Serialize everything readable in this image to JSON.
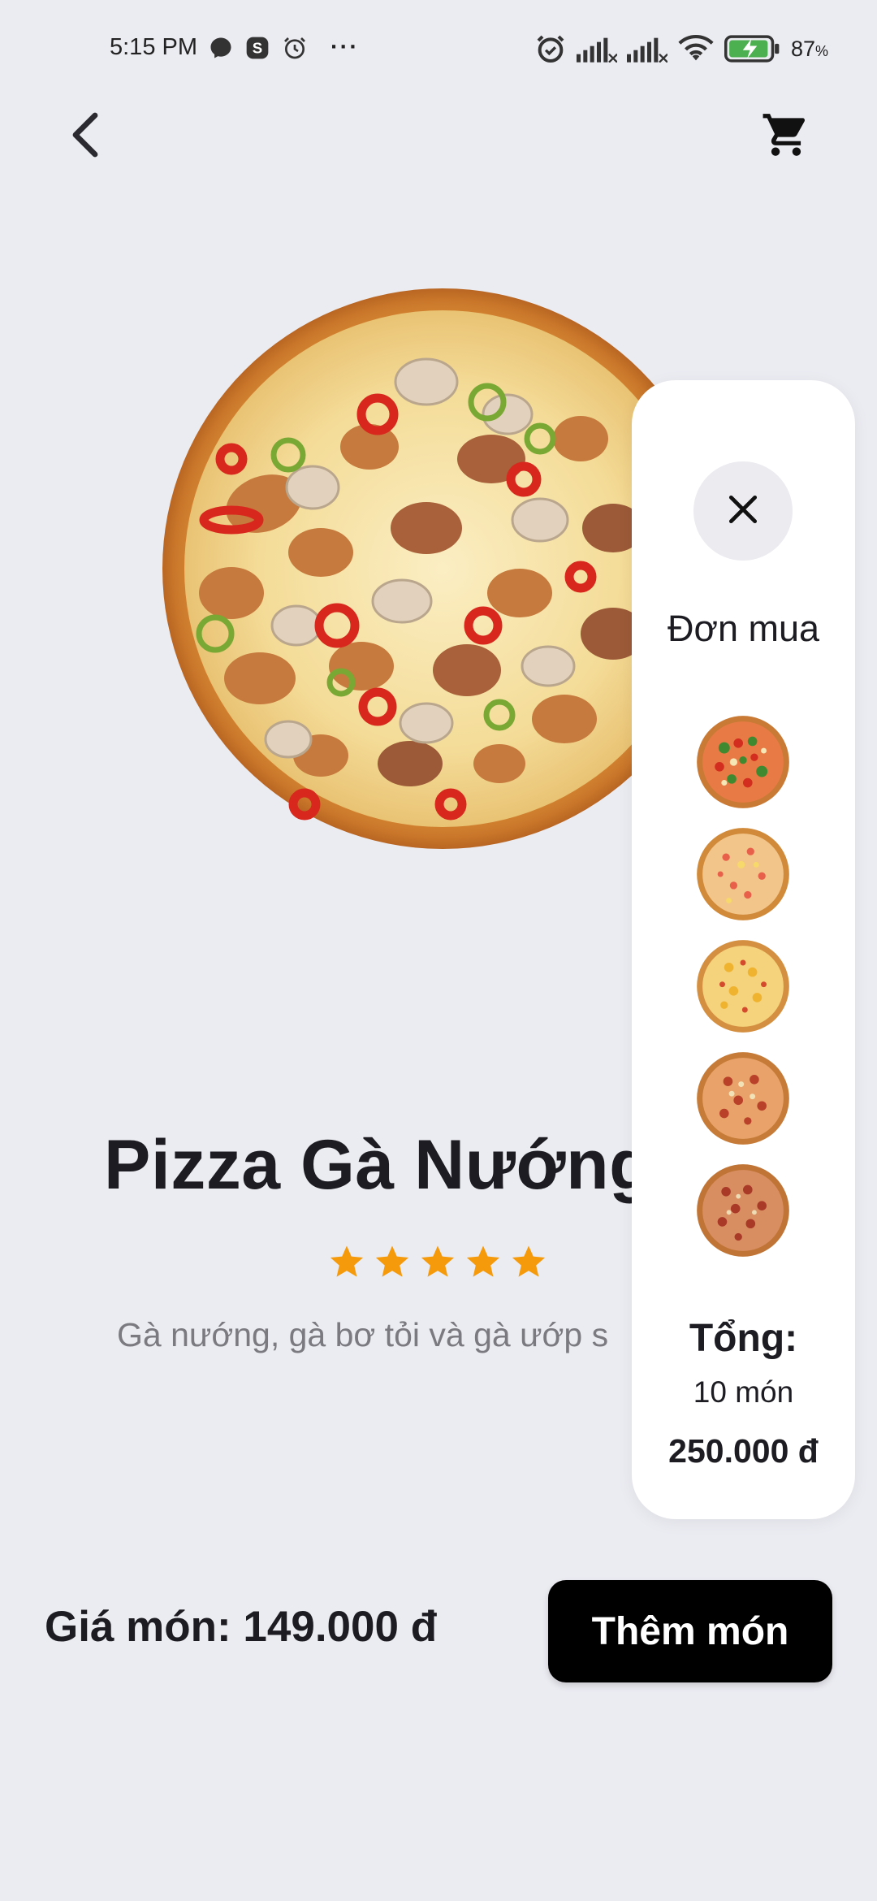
{
  "status_bar": {
    "time": "5:15 PM",
    "battery": "87",
    "battery_unit": "%",
    "more": "···",
    "icons": [
      "messenger-icon",
      "skype-icon",
      "alarm-icon",
      "alarm-clock-icon",
      "signal-icon",
      "signal-icon",
      "wifi-icon",
      "battery-charging-icon"
    ]
  },
  "header": {
    "back_icon": "chevron-left-icon",
    "cart_icon": "shopping-cart-icon"
  },
  "product": {
    "title": "Pizza Gà Nướng",
    "rating": 5,
    "rating_max": 5,
    "description": "Gà nướng, gà bơ tỏi và gà ướp s",
    "price_label": "Giá món: 149.000 đ"
  },
  "actions": {
    "add_label": "Thêm món"
  },
  "cart_panel": {
    "close_icon": "close-icon",
    "title": "Đơn mua",
    "items_count_shown": 5,
    "total_label": "Tổng:",
    "total_count": "10 món",
    "total_amount": "250.000 đ"
  },
  "colors": {
    "background": "#ebebf2",
    "accent_star": "#f59b0b",
    "button": "#000000",
    "panel": "#ffffff"
  }
}
